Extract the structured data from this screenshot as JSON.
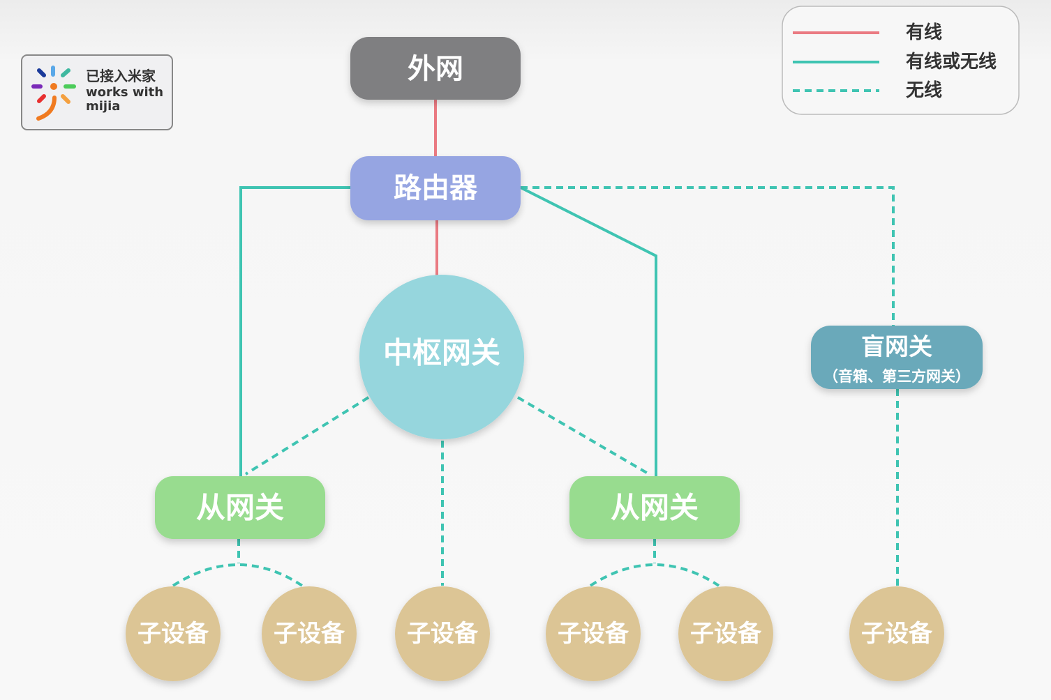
{
  "logo": {
    "line1": "已接入米家",
    "line2": "works with",
    "line3": "mijia"
  },
  "legend": {
    "items": [
      {
        "label": "有线",
        "style": "solid",
        "color": "#ea7a82"
      },
      {
        "label": "有线或无线",
        "style": "solid",
        "color": "#3fc4b2"
      },
      {
        "label": "无线",
        "style": "dashed",
        "color": "#3fc4b2"
      }
    ]
  },
  "nodes": {
    "internet": {
      "label": "外网",
      "color": "#7f7f81"
    },
    "router": {
      "label": "路由器",
      "color": "#96a5e2"
    },
    "hub": {
      "label": "中枢网关",
      "color": "#96d6dd"
    },
    "slave_left": {
      "label": "从网关",
      "color": "#98dc8f"
    },
    "slave_right": {
      "label": "从网关",
      "color": "#98dc8f"
    },
    "blind": {
      "label": "盲网关",
      "sublabel": "（音箱、第三方网关）",
      "color": "#6aa9ba"
    },
    "sub_devices": [
      {
        "label": "子设备"
      },
      {
        "label": "子设备"
      },
      {
        "label": "子设备"
      },
      {
        "label": "子设备"
      },
      {
        "label": "子设备"
      },
      {
        "label": "子设备"
      }
    ],
    "sub_color": "#dcc595"
  }
}
